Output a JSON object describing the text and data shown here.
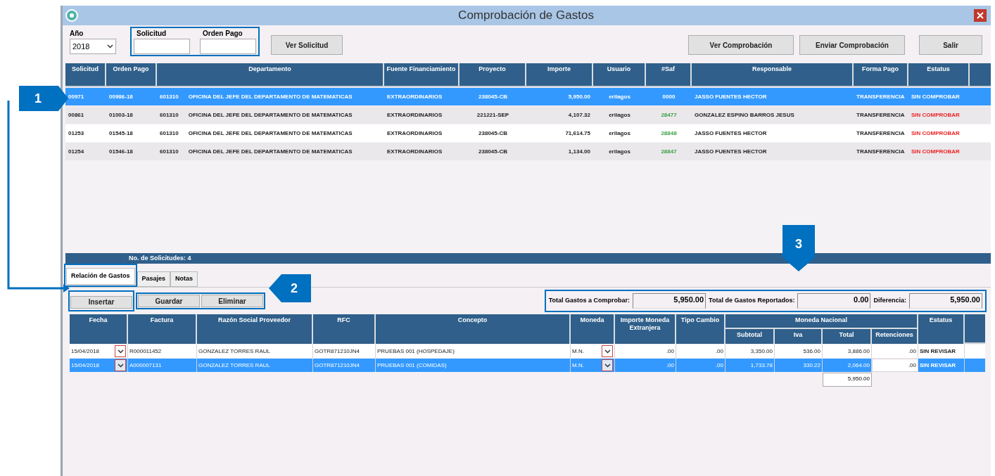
{
  "window": {
    "title": "Comprobación de Gastos"
  },
  "filters": {
    "year_label": "Año",
    "year": "2018",
    "solicitud_label": "Solicitud",
    "orden_pago_label": "Orden Pago"
  },
  "left_buttons": [
    "Ver Solicitud"
  ],
  "right_buttons": [
    "Ver Comprobación",
    "Enviar Comprobación",
    "Salir"
  ],
  "requests": {
    "columns": [
      "Solicitud",
      "Orden Pago",
      "Departamento",
      "Fuente Financiamiento",
      "Proyecto",
      "Importe",
      "Usuario",
      "#Saf",
      "Responsable",
      "Forma Pago",
      "Estatus"
    ],
    "rows": [
      {
        "selected": true,
        "solicitud": "00971",
        "orden": "00986-18",
        "dept_code": "601310",
        "department": "OFICINA DEL JEFE DEL DEPARTAMENTO DE MATEMATICAS",
        "fuente": "EXTRAORDINARIOS",
        "proyecto": "238045-CB",
        "importe": "5,950.00",
        "usuario": "erilagos",
        "saf": "0000",
        "responsable": "JASSO FUENTES HECTOR",
        "forma": "TRANSFERENCIA",
        "estatus": "SIN COMPROBAR"
      },
      {
        "selected": false,
        "solicitud": "00861",
        "orden": "01003-18",
        "dept_code": "601310",
        "department": "OFICINA DEL JEFE DEL DEPARTAMENTO DE MATEMATICAS",
        "fuente": "EXTRAORDINARIOS",
        "proyecto": "221221-SEP",
        "importe": "4,107.32",
        "usuario": "erilagos",
        "saf": "28477",
        "responsable": "GONZALEZ ESPINO BARROS JESUS",
        "forma": "TRANSFERENCIA",
        "estatus": "SIN COMPROBAR"
      },
      {
        "selected": false,
        "solicitud": "01253",
        "orden": "01545-18",
        "dept_code": "601310",
        "department": "OFICINA DEL JEFE DEL DEPARTAMENTO DE MATEMATICAS",
        "fuente": "EXTRAORDINARIOS",
        "proyecto": "238045-CB",
        "importe": "71,614.75",
        "usuario": "erilagos",
        "saf": "28848",
        "responsable": "JASSO FUENTES HECTOR",
        "forma": "TRANSFERENCIA",
        "estatus": "SIN COMPROBAR"
      },
      {
        "selected": false,
        "solicitud": "01254",
        "orden": "01546-18",
        "dept_code": "601310",
        "department": "OFICINA DEL JEFE DEL DEPARTAMENTO DE MATEMATICAS",
        "fuente": "EXTRAORDINARIOS",
        "proyecto": "238045-CB",
        "importe": "1,134.00",
        "usuario": "erilagos",
        "saf": "28847",
        "responsable": "JASSO FUENTES HECTOR",
        "forma": "TRANSFERENCIA",
        "estatus": "SIN COMPROBAR"
      }
    ],
    "footer": "No. de Solicitudes: 4"
  },
  "tabs": [
    {
      "label": "Relación de Gastos",
      "selected": true
    },
    {
      "label": "Pasajes",
      "selected": false
    },
    {
      "label": "Notas",
      "selected": false
    }
  ],
  "actions": [
    "Insertar",
    "Guardar",
    "Eliminar"
  ],
  "totals": [
    {
      "label": "Total Gastos a Comprobar:",
      "value": "5,950.00"
    },
    {
      "label": "Total de Gastos Reportados:",
      "value": "0.00"
    },
    {
      "label": "Diferencia:",
      "value": "5,950.00"
    }
  ],
  "expenses": {
    "columns": [
      "Fecha",
      "Factura",
      "Razón Social Proveedor",
      "RFC",
      "Concepto",
      "Moneda",
      "Importe Moneda Extranjera",
      "Tipo Cambio"
    ],
    "group": "Moneda Nacional",
    "group_columns": [
      "Subtotal",
      "Iva",
      "Total",
      "Retenciones"
    ],
    "status_column": "Estatus",
    "rows": [
      {
        "selected": false,
        "fecha": "15/04/2018",
        "factura": "R000011452",
        "razon": "GONZALEZ TORRES RAUL",
        "rfc": "GOTR871210JN4",
        "concepto": "PRUEBAS 001 (HOSPEDAJE)",
        "moneda": "M.N.",
        "importe_me": ".00",
        "tipo_cambio": ".00",
        "subtotal": "3,350.00",
        "iva": "536.00",
        "total": "3,886.00",
        "retenciones": ".00",
        "estatus": "SIN REVISAR"
      },
      {
        "selected": true,
        "fecha": "15/04/2018",
        "factura": "A000007131",
        "razon": "GONZALEZ TORRES RAUL",
        "rfc": "GOTR871210JN4",
        "concepto": "PRUEBAS 001 (COMIDAS)",
        "moneda": "M.N.",
        "importe_me": ".00",
        "tipo_cambio": ".00",
        "subtotal": "1,733.78",
        "iva": "330.22",
        "total": "2,064.00",
        "retenciones": ".00",
        "estatus": "SIN REVISAR"
      }
    ],
    "grand_total": "5,950.00"
  },
  "callouts": [
    "1",
    "2",
    "3"
  ]
}
